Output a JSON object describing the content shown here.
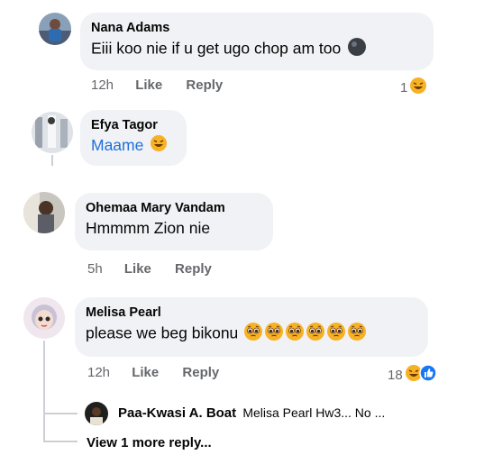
{
  "comments": [
    {
      "author": "Nana Adams",
      "text": "Eiii koo nie if u get ugo chop am too",
      "time": "12h",
      "like": "Like",
      "reply": "Reply",
      "reaction_count": "1"
    },
    {
      "author": "Efya Tagor",
      "text": "Maame"
    },
    {
      "author": "Ohemaa Mary Vandam",
      "text": "Hmmmm Zion nie",
      "time": "5h",
      "like": "Like",
      "reply": "Reply"
    },
    {
      "author": "Melisa Pearl",
      "text": "please we beg bikonu",
      "time": "12h",
      "like": "Like",
      "reply": "Reply",
      "reaction_count": "18"
    }
  ],
  "reply_preview": {
    "author": "Paa-Kwasi A. Boat",
    "snippet": "Melisa Pearl Hw3... No ..."
  },
  "view_more": "View 1 more reply...",
  "colors": {
    "bubble": "#f0f2f5",
    "link": "#216fdb",
    "muted": "#65676b",
    "like_blue": "#1877f2",
    "laugh_yellow": "#f7b125"
  },
  "icons": [
    "laugh-emoji",
    "pleading-face-emoji",
    "like-thumb-icon",
    "dark-ball-emoji"
  ]
}
